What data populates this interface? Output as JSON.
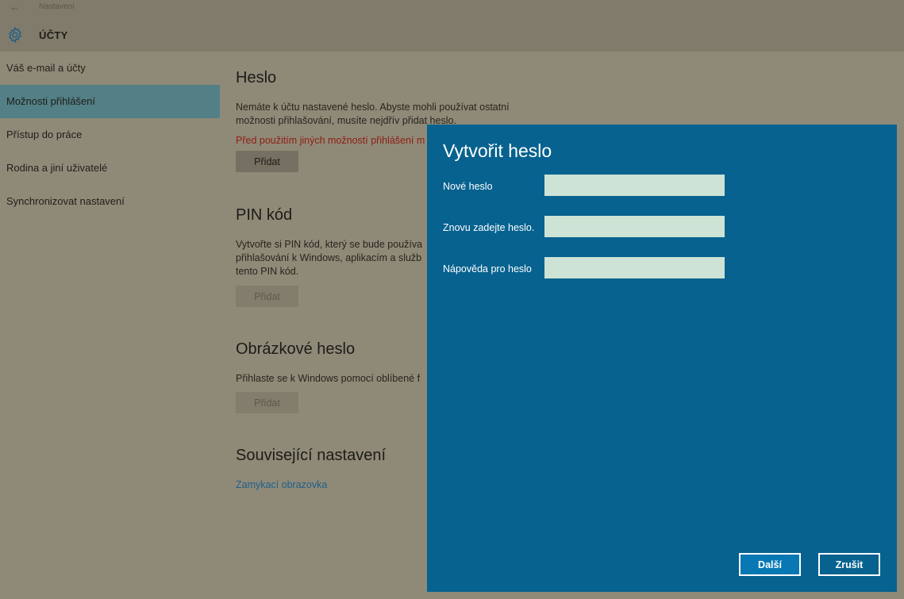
{
  "window": {
    "back_glyph": "←",
    "title": "Nastavení",
    "section": "ÚČTY",
    "icon": "gear-icon"
  },
  "sidebar": {
    "items": [
      {
        "label": "Váš e-mail a účty",
        "selected": false
      },
      {
        "label": "Možnosti přihlášení",
        "selected": true
      },
      {
        "label": "Přístup do práce",
        "selected": false
      },
      {
        "label": "Rodina a jiní uživatelé",
        "selected": false
      },
      {
        "label": "Synchronizovat nastavení",
        "selected": false
      }
    ]
  },
  "main": {
    "password": {
      "heading": "Heslo",
      "text": "Nemáte k účtu nastavené heslo. Abyste mohli používat ostatní možnosti přihlašování, musíte nejdřív přidat heslo.",
      "warning": "Před použitím jiných možností přihlášení m",
      "button": "Přidat"
    },
    "pin": {
      "heading": "PIN kód",
      "text_lines": [
        "Vytvořte si PIN kód, který se bude používa",
        "přihlašování k Windows, aplikacím a služb",
        "tento PIN kód."
      ],
      "button": "Přidat"
    },
    "picture": {
      "heading": "Obrázkové heslo",
      "text": "Přihlaste se k Windows pomocí oblíbené f",
      "button": "Přidat"
    },
    "related": {
      "heading": "Související nastavení",
      "link": "Zamykací obrazovka"
    }
  },
  "dialog": {
    "title": "Vytvořit heslo",
    "fields": [
      {
        "label": "Nové heslo",
        "value": ""
      },
      {
        "label": "Znovu zadejte heslo.",
        "value": ""
      },
      {
        "label": "Nápověda pro heslo",
        "value": ""
      }
    ],
    "next_button": "Další",
    "cancel_button": "Zrušit"
  },
  "colors": {
    "accent": "#07628f",
    "dialog_input": "#cce3d6",
    "warning": "#8f1d12",
    "selected": "#537f86"
  }
}
